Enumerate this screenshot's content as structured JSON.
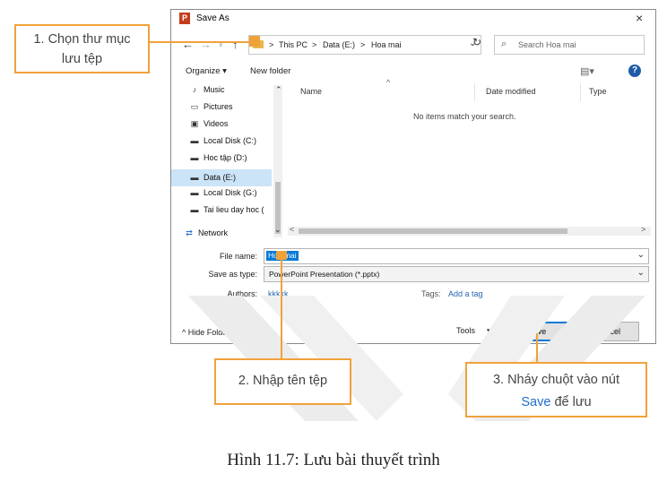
{
  "dialog": {
    "title": "Save As",
    "app_icon_letter": "P",
    "close": "×",
    "nav": {
      "back": "←",
      "forward": "→",
      "up": "↑",
      "dropdown": "∨"
    },
    "breadcrumb": [
      ">",
      "This PC",
      ">",
      "Data (E:)",
      ">",
      "Hoa mai"
    ],
    "address_chevron": "⌄",
    "refresh": "↻",
    "search_placeholder": "Search Hoa mai",
    "toolbar": {
      "organize": "Organize ▾",
      "new_folder": "New folder",
      "view": "▤▾",
      "help": "?"
    },
    "nav_items": [
      {
        "label": "Music",
        "icon": "music-icon",
        "glyph": "♪"
      },
      {
        "label": "Pictures",
        "icon": "pictures-icon",
        "glyph": "▭"
      },
      {
        "label": "Videos",
        "icon": "videos-icon",
        "glyph": "▣"
      },
      {
        "label": "Local Disk (C:)",
        "icon": "drive-icon",
        "glyph": "▬"
      },
      {
        "label": "Hoc tập (D:)",
        "icon": "drive-icon",
        "glyph": "▬"
      },
      {
        "label": "Data (E:)",
        "icon": "drive-icon",
        "glyph": "▬",
        "selected": true
      },
      {
        "label": "Local Disk (G:)",
        "icon": "drive-icon",
        "glyph": "▬"
      },
      {
        "label": "Tai lieu day hoc (",
        "icon": "drive-icon",
        "glyph": "▬"
      },
      {
        "label": "Network",
        "icon": "network-icon",
        "glyph": "⇄"
      }
    ],
    "nav_scroll_up": "⌃",
    "nav_scroll_down": "⌄",
    "columns": [
      "Name",
      "Date modified",
      "Type"
    ],
    "sort_caret": "^",
    "empty_message": "No items match your search.",
    "hscroll_left": "<",
    "hscroll_right": ">",
    "file_name_label": "File name:",
    "file_name_value": "Hoa mai",
    "save_type_label": "Save as type:",
    "save_type_value": "PowerPoint Presentation (*.pptx)",
    "authors_label": "Authors:",
    "authors_value": "kkkkk",
    "tags_label": "Tags:",
    "tags_value": "Add a tag",
    "hide_folders": "^ Hide Folders",
    "tools": "Tools",
    "tools_caret": "▾",
    "save_button": "Save",
    "cancel_button": "Cancel"
  },
  "callouts": {
    "c1_line1": "1. Chọn thư mục",
    "c1_line2": "lưu tệp",
    "c2": "2. Nhập tên tệp",
    "c3_line1": "3. Nháy chuột vào nút",
    "c3_save": "Save",
    "c3_rest": " để lưu"
  },
  "caption": "Hình 11.7: Lưu bài thuyết trình",
  "colors": {
    "accent": "#f0a23a",
    "link": "#2864b4",
    "selection": "#0078d7",
    "save_word": "#1e6fd0"
  }
}
